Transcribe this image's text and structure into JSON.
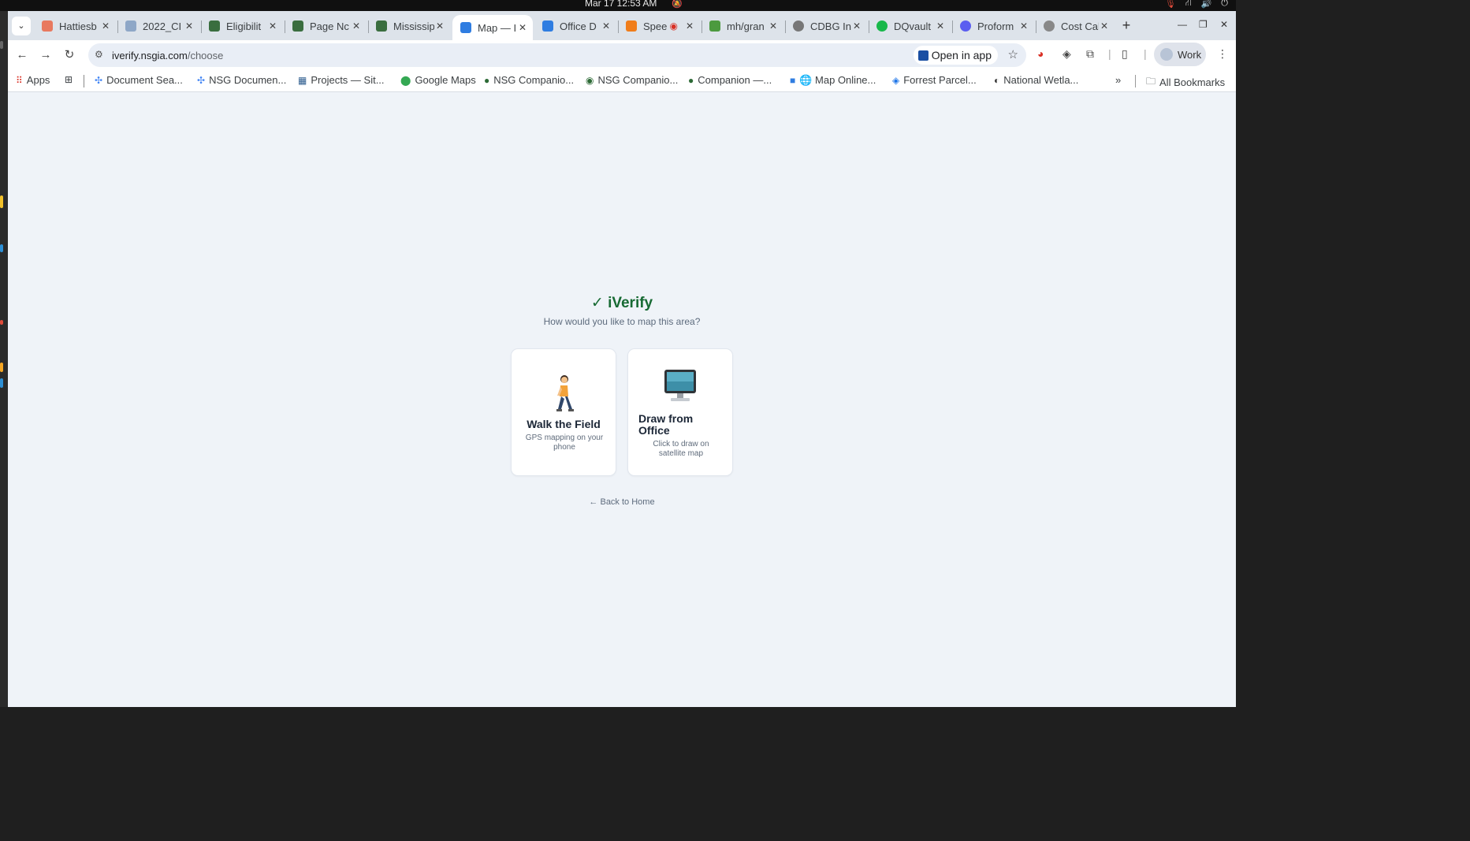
{
  "os": {
    "clock": "Mar 17  12:53 AM",
    "bell": "🔕",
    "tray": [
      "🎙",
      "⛙",
      "🔊",
      "⏻"
    ]
  },
  "tabs": [
    {
      "title": "Hattiesb",
      "fav_color": "#e8795f"
    },
    {
      "title": "2022_CI",
      "fav_color": "#8ea7c7"
    },
    {
      "title": "Eligibilit",
      "fav_color": "#3a6e3f"
    },
    {
      "title": "Page Nc",
      "fav_color": "#3a6e3f"
    },
    {
      "title": "Mississip",
      "fav_color": "#3a6e3f"
    },
    {
      "title": "Map — I",
      "fav_color": "#2f7de1",
      "active": true
    },
    {
      "title": "Office D",
      "fav_color": "#2f7de1"
    },
    {
      "title": "Spee",
      "fav_color": "#f07d1a"
    },
    {
      "title": "mh/gran",
      "fav_color": "#4c9a3f"
    },
    {
      "title": "CDBG In",
      "fav_color": "#777777"
    },
    {
      "title": "DQvault",
      "fav_color": "#18b84a"
    },
    {
      "title": "Proform",
      "fav_color": "#5b5ef0"
    },
    {
      "title": "Cost Cal",
      "fav_color": "#888888"
    }
  ],
  "toolbar": {
    "url_host": "iverify.nsgia.com",
    "url_path": "/choose",
    "open_in_app": "Open in app",
    "profile": "Work"
  },
  "bookmarks": {
    "apps": "Apps",
    "items": [
      "Document Sea...",
      "NSG Documen...",
      "Projects — Sit...",
      "Google Maps",
      "NSG Companio...",
      "NSG Companio...",
      "Companion —...",
      "🌐 Map Online...",
      "Forrest Parcel...",
      "National Wetla..."
    ],
    "more": "»",
    "all": "All Bookmarks"
  },
  "page": {
    "brand": "✓ iVerify",
    "subtitle": "How would you like to map this area?",
    "walk_title": "Walk the Field",
    "walk_desc": "GPS mapping on your phone",
    "office_title": "Draw from Office",
    "office_desc": "Click to draw on satellite map",
    "back": "← Back to Home"
  },
  "colors": {
    "brand": "#176a33",
    "page_bg": "#eff3f8",
    "card_bg": "#ffffff"
  }
}
